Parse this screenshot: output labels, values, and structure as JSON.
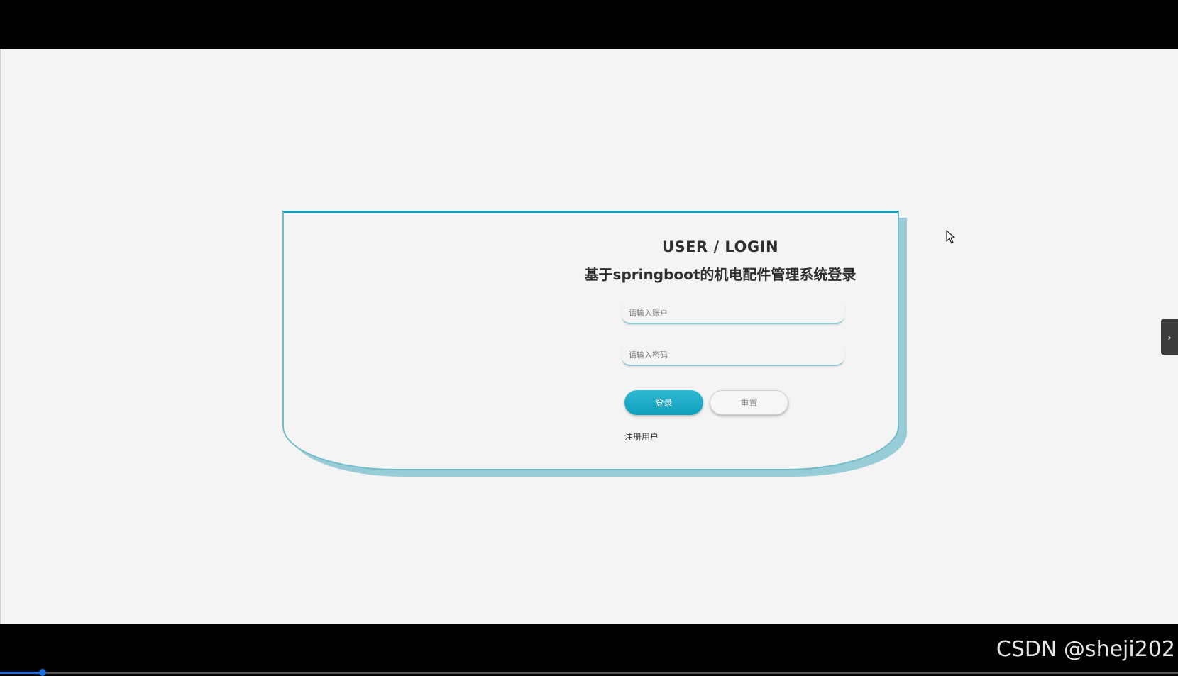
{
  "login": {
    "title": "USER / LOGIN",
    "subtitle": "基于springboot的机电配件管理系统登录",
    "username_placeholder": "请输入账户",
    "password_placeholder": "请输入密码",
    "login_label": "登录",
    "reset_label": "重置",
    "register_label": "注册用户"
  },
  "sidebar_toggle": {
    "glyph": "›"
  },
  "video": {
    "progress": 0.036
  },
  "watermark": "CSDN @sheji202",
  "colors": {
    "accent": "#1b9fb4",
    "button": "#17a7c4",
    "shadow": "#98ccd6",
    "background": "#f4f4f4"
  }
}
